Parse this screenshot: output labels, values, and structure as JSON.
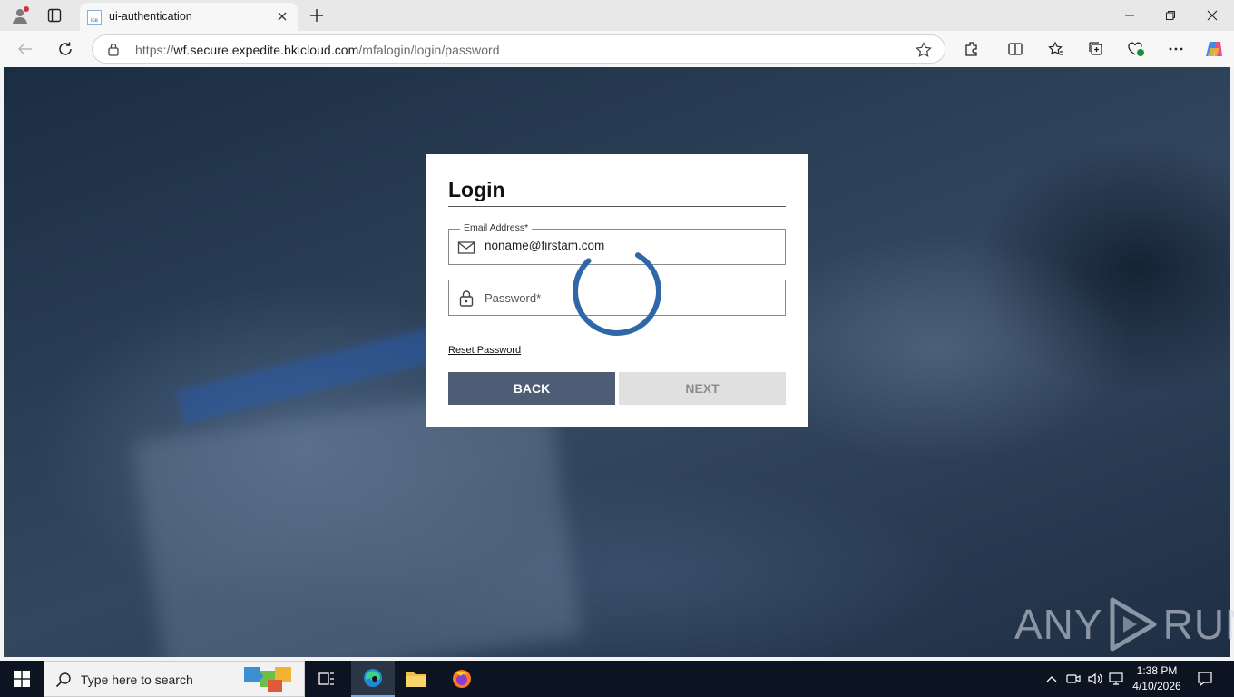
{
  "browser": {
    "tab_title": "ui-authentication",
    "favicon_text": "ice",
    "url_prefix": "https://",
    "url_host": "wf.secure.expedite.bkicloud.com",
    "url_path": "/mfalogin/login/password"
  },
  "login": {
    "title": "Login",
    "email_label": "Email Address*",
    "email_value": "noname@firstam.com",
    "password_placeholder": "Password*",
    "reset_link": "Reset Password",
    "back_label": "BACK",
    "next_label": "NEXT",
    "loading": true
  },
  "watermark": {
    "left": "ANY",
    "right": "RUN"
  },
  "taskbar": {
    "search_placeholder": "Type here to search",
    "time": "1:38 PM",
    "date": "4/10/2026"
  },
  "colors": {
    "back_button": "#4f5c75",
    "next_button_disabled": "#e0e0e0",
    "spinner": "#2f67a8"
  }
}
